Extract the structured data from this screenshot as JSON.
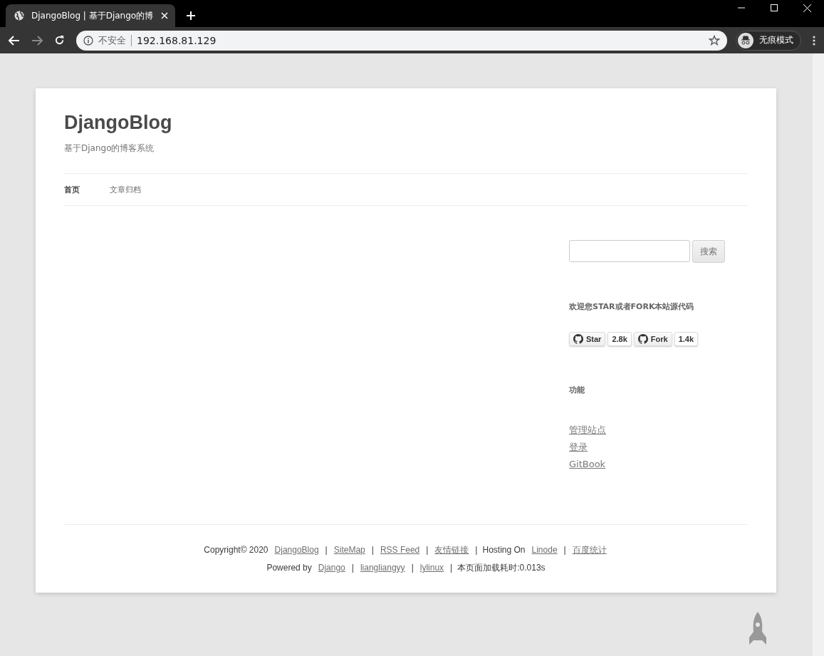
{
  "browser": {
    "tab_title": "DjangoBlog | 基于Django的博",
    "security_label": "不安全",
    "url": "192.168.81.129",
    "incognito_label": "无痕模式"
  },
  "site": {
    "title": "DjangoBlog",
    "subtitle": "基于Django的博客系统"
  },
  "nav": [
    {
      "label": "首页",
      "selected": true
    },
    {
      "label": "文章归档",
      "selected": false
    }
  ],
  "sidebar": {
    "search_button": "搜索",
    "star_heading": "欢迎您STAR或者FORK本站源代码",
    "github_buttons": [
      {
        "label": "Star",
        "count": "2.8k"
      },
      {
        "label": "Fork",
        "count": "1.4k"
      }
    ],
    "links_heading": "功能",
    "links": [
      "管理站点",
      "登录",
      "GitBook"
    ]
  },
  "footer": [
    [
      {
        "text": "Copyright© 2020",
        "link": false
      },
      {
        "text": "DjangoBlog",
        "link": true
      },
      {
        "text": "|",
        "link": false
      },
      {
        "text": "SiteMap",
        "link": true
      },
      {
        "text": "|",
        "link": false
      },
      {
        "text": "RSS Feed",
        "link": true
      },
      {
        "text": "|",
        "link": false
      },
      {
        "text": "友情链接",
        "link": true
      },
      {
        "text": "|",
        "link": false
      },
      {
        "text": "Hosting On",
        "link": false
      },
      {
        "text": "Linode",
        "link": true
      },
      {
        "text": "|",
        "link": false
      },
      {
        "text": "百度统计",
        "link": true
      }
    ],
    [
      {
        "text": "Powered by",
        "link": false
      },
      {
        "text": "Django",
        "link": true
      },
      {
        "text": "|",
        "link": false
      },
      {
        "text": "liangliangyy",
        "link": true
      },
      {
        "text": "|",
        "link": false
      },
      {
        "text": "lylinux",
        "link": true
      },
      {
        "text": "|",
        "link": false
      },
      {
        "text": "本页面加载耗时:0.013s",
        "link": false
      }
    ]
  ]
}
